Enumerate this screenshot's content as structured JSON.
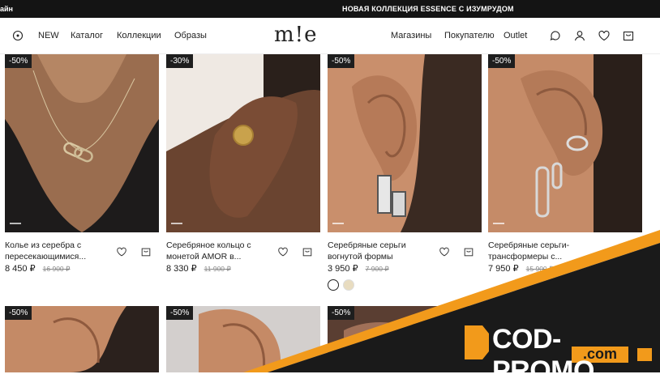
{
  "topbar": {
    "left_text": "айн",
    "announcement": "НОВАЯ КОЛЛЕКЦИЯ ESSENCE С ИЗУМРУДОМ"
  },
  "nav": {
    "logo": "m!e",
    "left_items": [
      "NEW",
      "Каталог",
      "Коллекции",
      "Образы"
    ],
    "right_items": [
      "Магазины",
      "Покупателю",
      "Outlet"
    ]
  },
  "icons": {
    "location": "location-pin-icon",
    "chat": "chat-icon",
    "profile": "user-icon",
    "favorite": "heart-icon",
    "cart": "bag-icon"
  },
  "products": [
    {
      "badge": "-50%",
      "name": "Колье из серебра с пересекающимися...",
      "price": "8 450 ₽",
      "old_price": "16 900 ₽"
    },
    {
      "badge": "-30%",
      "name": "Серебряное кольцо с монетой AMOR в...",
      "price": "8 330 ₽",
      "old_price": "11 900 ₽"
    },
    {
      "badge": "-50%",
      "name": "Серебряные серьги вогнутой формы",
      "price": "3 950 ₽",
      "old_price": "7 900 ₽"
    },
    {
      "badge": "-50%",
      "name": "Серебряные серьги-трансформеры с...",
      "price": "7 950 ₽",
      "old_price": "15 900 ₽"
    }
  ],
  "second_row_badges": [
    "-50%",
    "-50%",
    "-50%"
  ],
  "swatches": [
    "#ffffff",
    "#e8dcc0"
  ],
  "colors": {
    "banner_orange": "#f29a1b",
    "banner_dark": "#1a1a1a",
    "badge_bg": "#1e1e1e"
  },
  "promo": {
    "brand": "COD-PROMO",
    "domain": ".com"
  }
}
